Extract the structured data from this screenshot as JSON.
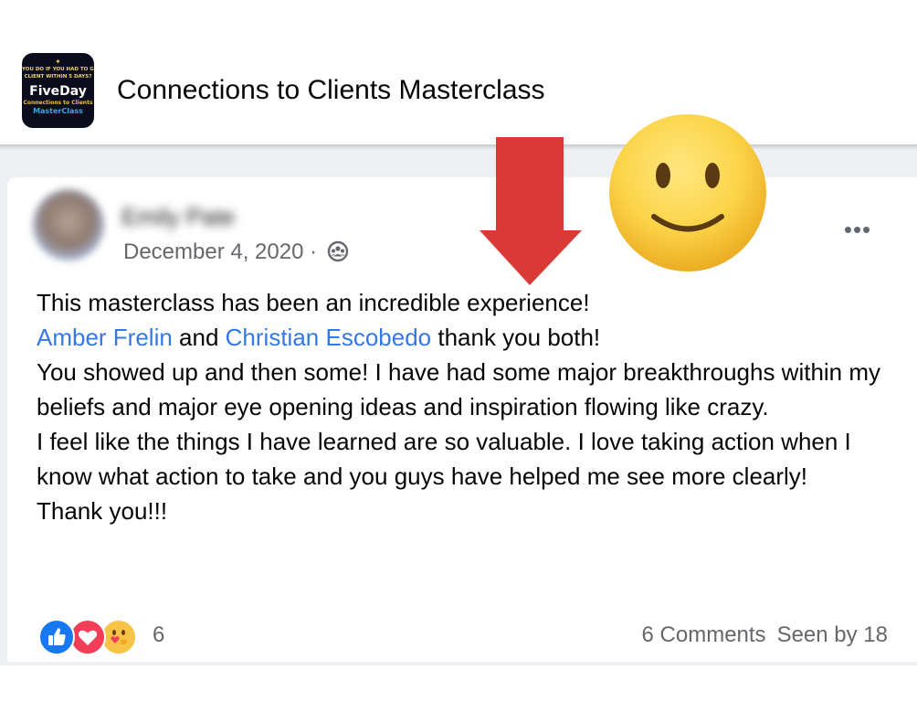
{
  "group": {
    "name": "Connections to Clients Masterclass",
    "logo": {
      "question": "YOU DO IF YOU HAD TO GE",
      "question2": "CLIENT WITHIN 5 DAYS?",
      "brand": "FiveDay",
      "subtitle": "Connections to Clients",
      "subtitle2": "MasterClass"
    }
  },
  "post": {
    "author": "Emily Pate",
    "date": "December 4, 2020",
    "separator": " · ",
    "privacy_icon": "group-icon",
    "more_label": "•••",
    "line1": "This masterclass has been an incredible experience!",
    "mention1": "Amber Frelin",
    "and_text": " and ",
    "mention2": "Christian Escobedo",
    "thanks_text": " thank you both!",
    "paragraph2": "You showed up and then some! I have had some major breakthroughs within my beliefs and major eye opening ideas and inspiration flowing like crazy.",
    "paragraph3": "I feel like the things I have learned are so valuable. I love taking action when I know what action to take and you guys have helped me see more clearly!",
    "paragraph4": "Thank you!!!"
  },
  "footer": {
    "reactions": [
      "like-icon",
      "love-icon",
      "care-icon"
    ],
    "reaction_count": "6",
    "comments": "6 Comments",
    "seen_by": "Seen by 18"
  },
  "overlay": {
    "arrow_icon": "down-arrow-icon",
    "arrow_color": "#d93a35",
    "emoji_icon": "slightly-smiling-face-emoji"
  },
  "colors": {
    "link": "#3578e5",
    "secondary_text": "#65676b",
    "feed_background": "#eef0f3",
    "like": "#1877f2",
    "love": "#f33e58",
    "care": "#f7c447"
  }
}
